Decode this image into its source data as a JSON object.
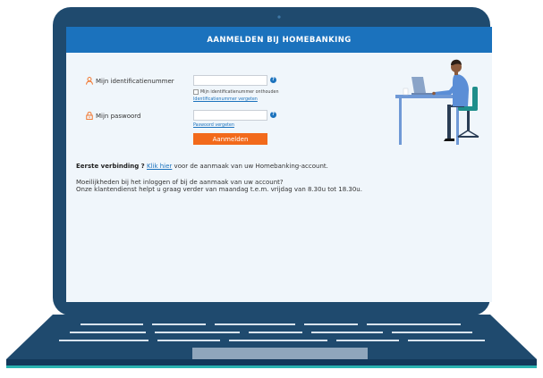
{
  "header": {
    "title": "AANMELDEN BIJ HOMEBANKING"
  },
  "form": {
    "id_label": "Mijn identificatienummer",
    "id_value": "",
    "remember_label": "Mijn identificatienummer onthouden",
    "forgot_id_link": "Identificatienummer vergeten",
    "password_label": "Mijn paswoord",
    "password_value": "",
    "forgot_password_link": "Paswoord vergeten",
    "login_button": "Aanmelden",
    "help_glyph": "?"
  },
  "info": {
    "first_connection_bold": "Eerste verbinding ?",
    "click_here_link": "Klik hier",
    "first_connection_rest": "voor de aanmaak van uw Homebanking-account.",
    "trouble_line1": "Moeilijkheden bij het inloggen of bij de aanmaak van uw account?",
    "trouble_line2": "Onze klantendienst helpt u graag verder van maandag t.e.m. vrijdag van 8.30u tot 18.30u."
  },
  "icons": {
    "user": "user-icon",
    "lock": "lock-icon",
    "help": "help-icon",
    "illustration": "person-at-desk-illustration"
  },
  "colors": {
    "header_blue": "#1b72bd",
    "accent_orange": "#f26a1b",
    "laptop_frame": "#1f4a6e",
    "screen_bg": "#f0f6fb",
    "laptop_teal": "#2bb3b1"
  }
}
